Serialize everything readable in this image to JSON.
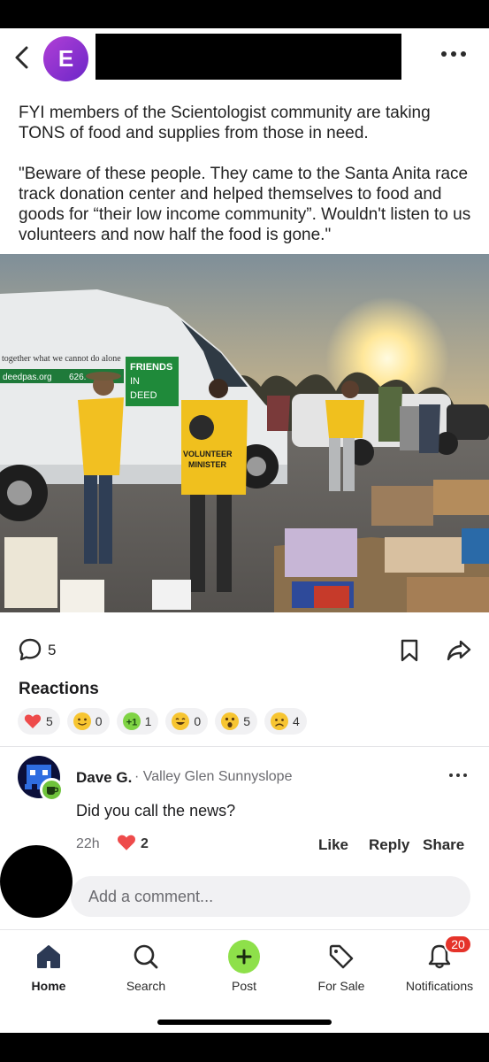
{
  "header": {
    "avatar_letter": "E",
    "more_icon": "more-horizontal-icon",
    "back_icon": "chevron-left-icon"
  },
  "post": {
    "paragraph1": "FYI members of the Scientologist community are taking TONS of food and supplies from those in need.",
    "paragraph2": "\"Beware of these people. They came to the Santa Anita race track donation center and helped themselves to food and goods for “their low income community”. Wouldn't listen to us volunteers and now half the food is gone.\"",
    "photo_van_text": "together what we cannot do alone",
    "photo_van_site": "deedpas.org",
    "photo_van_phone": "626.",
    "photo_sign_line1": "FRIENDS",
    "photo_sign_line2": "IN",
    "photo_sign_line3": "DEED",
    "photo_shirt_line1": "VOLUNTEER",
    "photo_shirt_line2": "MINISTER",
    "comment_count": "5"
  },
  "reactions": {
    "title": "Reactions",
    "items": [
      {
        "icon": "heart-icon",
        "count": "5"
      },
      {
        "icon": "smile-emoji-icon",
        "count": "0"
      },
      {
        "icon": "plus-one-icon",
        "label": "+1",
        "count": "1"
      },
      {
        "icon": "grin-emoji-icon",
        "count": "0"
      },
      {
        "icon": "surprised-emoji-icon",
        "count": "5"
      },
      {
        "icon": "sad-emoji-icon",
        "count": "4"
      }
    ]
  },
  "comment": {
    "author": "Dave G.",
    "location": "· Valley Glen Sunnyslope",
    "text": "Did you call the news?",
    "time": "22h",
    "heart_count": "2",
    "like_label": "Like",
    "reply_label": "Reply",
    "share_label": "Share"
  },
  "add_comment": {
    "placeholder": "Add a comment..."
  },
  "tabbar": {
    "home": "Home",
    "search": "Search",
    "post": "Post",
    "for_sale": "For Sale",
    "notifications": "Notifications",
    "notif_badge": "20"
  },
  "colors": {
    "accent_green": "#8ee04a",
    "avatar_purple": "#8a2fd0",
    "badge_red": "#e5332a"
  }
}
